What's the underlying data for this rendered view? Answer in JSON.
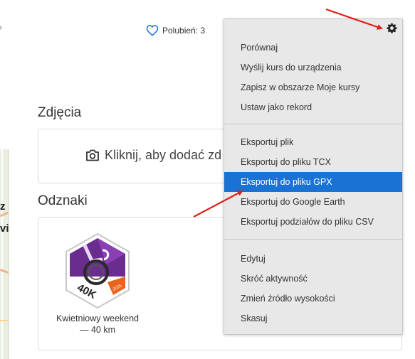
{
  "likes": {
    "label": "Polubień: 3"
  },
  "photos": {
    "title": "Zdjęcia",
    "cta": "Kliknij, aby dodać zd"
  },
  "badges": {
    "title": "Odznaki",
    "items": [
      {
        "caption_line1": "Kwietniowy weekend",
        "caption_line2": "— 40 km",
        "badge_text": "40K",
        "badge_year": "2025"
      }
    ]
  },
  "map_letters": [
    "z",
    "vi"
  ],
  "menu": {
    "groups": [
      [
        "Porównaj",
        "Wyślij kurs do urządzenia",
        "Zapisz w obszarze Moje kursy",
        "Ustaw jako rekord"
      ],
      [
        "Eksportuj plik",
        "Eksportuj do pliku TCX",
        "Eksportuj do pliku GPX",
        "Eksportuj do Google Earth",
        "Eksportuj podziałów do pliku CSV"
      ],
      [
        "Edytuj",
        "Skróć aktywność",
        "Zmień źródło wysokości",
        "Skasuj"
      ]
    ],
    "highlighted": "Eksportuj do pliku GPX"
  },
  "colors": {
    "highlight": "#1a73d4",
    "arrow": "#e0201c",
    "heart": "#1a73d4"
  }
}
